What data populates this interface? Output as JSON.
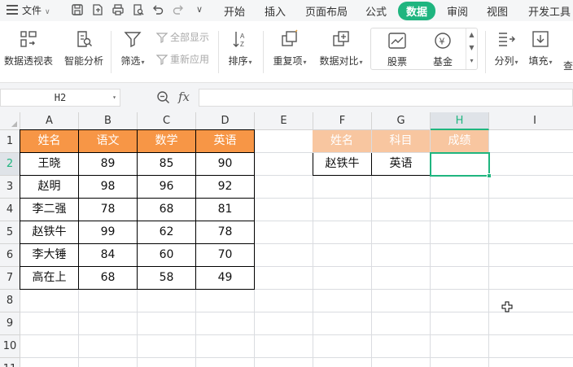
{
  "menubar": {
    "file_label": "文件",
    "tabs": [
      {
        "label": "开始",
        "active": false
      },
      {
        "label": "插入",
        "active": false
      },
      {
        "label": "页面布局",
        "active": false
      },
      {
        "label": "公式",
        "active": false
      },
      {
        "label": "数据",
        "active": true
      },
      {
        "label": "审阅",
        "active": false
      },
      {
        "label": "视图",
        "active": false
      },
      {
        "label": "开发工具",
        "active": false
      }
    ],
    "accent": "#1fb57f"
  },
  "ribbon": {
    "pivot": "数据透视表",
    "smart_analysis": "智能分析",
    "filter": "筛选",
    "show_all": "全部显示",
    "reapply": "重新应用",
    "sort": "排序",
    "duplicates": "重复项",
    "compare": "数据对比",
    "stock": "股票",
    "fund": "基金",
    "split": "分列",
    "fill": "填充",
    "find_partial": "查"
  },
  "formula_bar": {
    "cell_ref": "H2",
    "fx_label": "fx",
    "formula": ""
  },
  "grid": {
    "columns": [
      "A",
      "B",
      "C",
      "D",
      "E",
      "F",
      "G",
      "H",
      "I"
    ],
    "rows": [
      "1",
      "2",
      "3",
      "4",
      "5",
      "6",
      "7",
      "8",
      "9",
      "10",
      "11"
    ],
    "selected_column": "H",
    "selected_row": "2",
    "table1": {
      "headers": [
        "姓名",
        "语文",
        "数学",
        "英语"
      ],
      "header_color": "#f79646",
      "rows": [
        [
          "王晓",
          "89",
          "85",
          "90"
        ],
        [
          "赵明",
          "98",
          "96",
          "92"
        ],
        [
          "李二强",
          "78",
          "68",
          "81"
        ],
        [
          "赵铁牛",
          "99",
          "62",
          "78"
        ],
        [
          "李大锤",
          "84",
          "60",
          "70"
        ],
        [
          "高在上",
          "68",
          "58",
          "49"
        ]
      ]
    },
    "table2": {
      "headers": [
        "姓名",
        "科目",
        "成绩"
      ],
      "header_color": "#f8c6a0",
      "row": [
        "赵铁牛",
        "英语",
        ""
      ]
    }
  }
}
